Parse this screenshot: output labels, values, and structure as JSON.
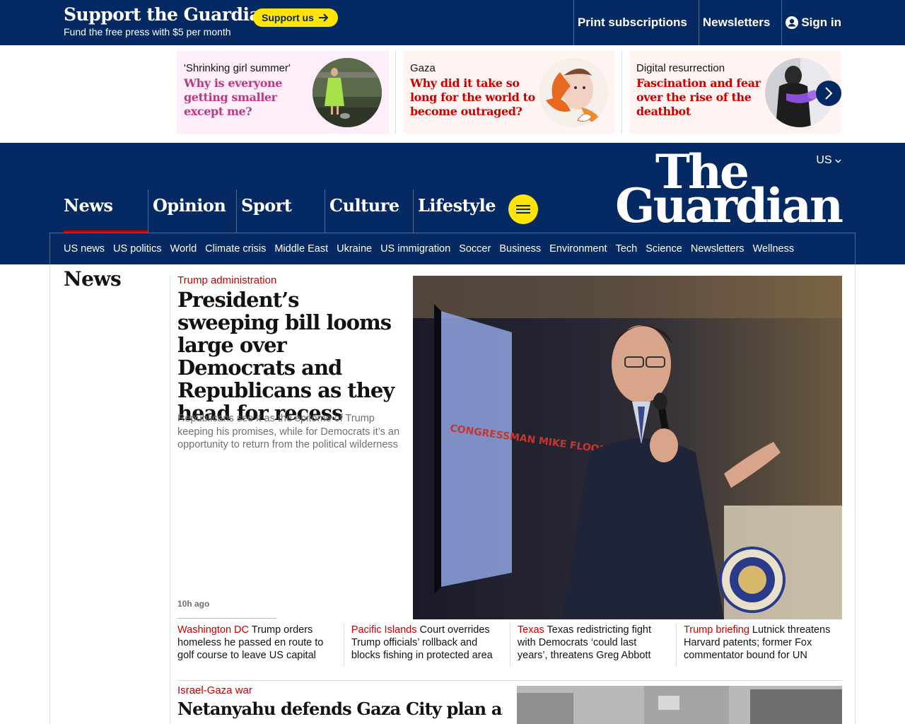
{
  "support": {
    "title": "Support the Guardian",
    "subtitle": "Fund the free press with $5 per month",
    "button": "Support us"
  },
  "top_links": {
    "print": "Print subscriptions",
    "newsletters": "Newsletters",
    "signin": "Sign in"
  },
  "promos": [
    {
      "kicker": "'Shrinking girl summer'",
      "headline": "Why is everyone getting smaller except me?",
      "bg": "#fdeefa",
      "color": "#bb3b80"
    },
    {
      "kicker": "Gaza",
      "headline": "Why did it take so long for the world to become outraged?",
      "bg": "#fff4f2",
      "color": "#c70000"
    },
    {
      "kicker": "Digital resurrection",
      "headline": "Fascination and fear over the rise of the deathbot",
      "bg": "#fff4f2",
      "color": "#c70000"
    }
  ],
  "masthead": {
    "edition": "US",
    "logo_line1": "The",
    "logo_line2": "Guardian",
    "pillars": [
      "News",
      "Opinion",
      "Sport",
      "Culture",
      "Lifestyle"
    ],
    "subnav": [
      "US news",
      "US politics",
      "World",
      "Climate crisis",
      "Middle East",
      "Ukraine",
      "US immigration",
      "Soccer",
      "Business",
      "Environment",
      "Tech",
      "Science",
      "Newsletters",
      "Wellness"
    ]
  },
  "section": {
    "title": "News"
  },
  "lead": {
    "kicker": "Trump administration",
    "headline": "President’s sweeping bill looms large over Democrats and Republicans as they head for recess",
    "standfirst": "Republicans see it as the epitome of Trump keeping his promises, while for Democrats it’s an opportunity to return from the political wilderness",
    "time": "10h ago",
    "image_sign": "CONGRESSMAN MIKE FLOOD"
  },
  "substories": [
    {
      "kicker": "Washington DC",
      "text": "Trump orders homeless he passed en route to golf course to leave US capital"
    },
    {
      "kicker": "Pacific Islands",
      "text": "Court overrides Trump officials’ rollback and blocks fishing in protected area"
    },
    {
      "kicker": "Texas",
      "text": "Texas redistricting fight with Democrats ‘could last years’, threatens Greg Abbott"
    },
    {
      "kicker": "Trump briefing",
      "text": "Lutnick threatens Harvard patents; former Fox commentator bound for UN"
    }
  ],
  "story2": {
    "kicker": "Israel-Gaza war",
    "headline": "Netanyahu defends Gaza City plan as UN"
  },
  "colors": {
    "brand": "#052962",
    "accent_yellow": "#ffe500",
    "news_red": "#c70000"
  }
}
